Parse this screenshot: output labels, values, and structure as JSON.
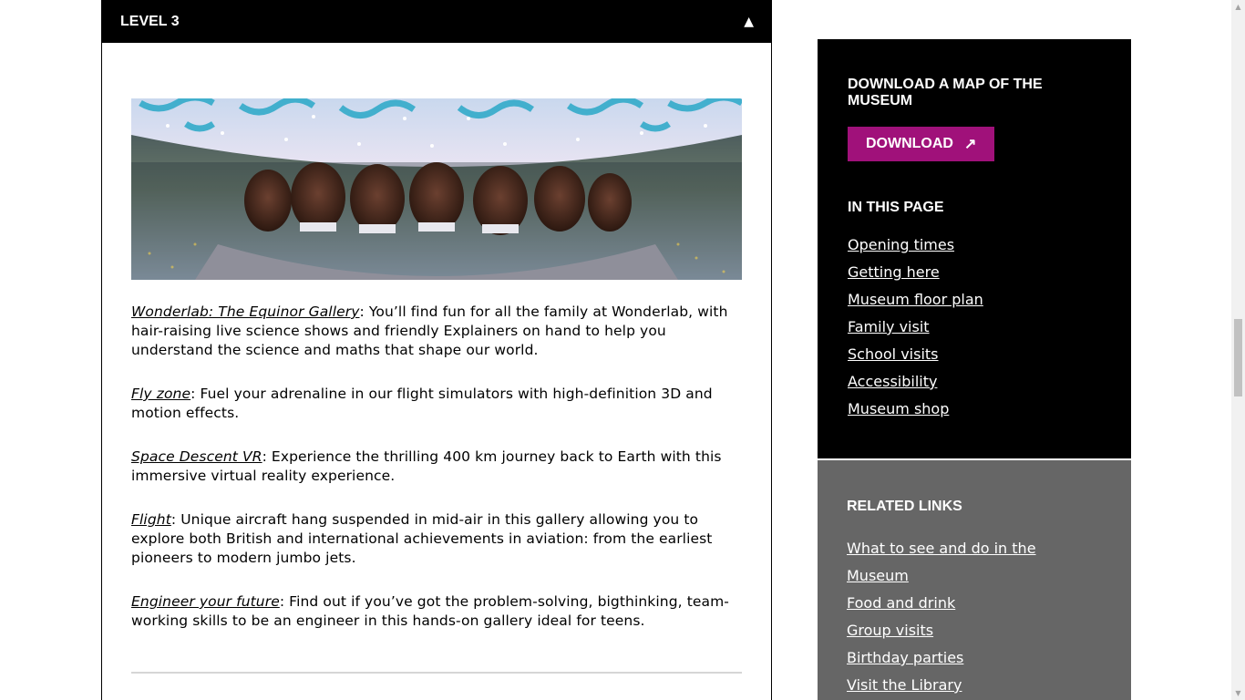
{
  "accordion": {
    "title": "LEVEL 3",
    "toggle_icon": "▲"
  },
  "hero_image": {
    "alt_name": "wonderlab-mirror-photo"
  },
  "galleries": [
    {
      "name": "Wonderlab: The Equinor Gallery",
      "text": ": You’ll find fun for all the family at Wonderlab, with hair-raising live science shows and friendly Explainers on hand to help you understand the science and maths that shape our world."
    },
    {
      "name": "Fly zone",
      "text": ": Fuel your adrenaline in our flight simulators with high-definition 3D and motion effects."
    },
    {
      "name": "Space Descent VR",
      "text": ": Experience the thrilling 400 km journey back to Earth with this immersive virtual reality experience."
    },
    {
      "name": "Flight",
      "text": ": Unique aircraft hang suspended in mid-air in this gallery allowing you to explore both British and international achievements in aviation: from the earliest pioneers to modern jumbo jets."
    },
    {
      "name": "Engineer your future",
      "text": ": Find out if you’ve got the problem-solving, bigthinking, team-working skills to be an engineer in this hands-on gallery ideal for teens."
    }
  ],
  "sidebar": {
    "download_heading": "DOWNLOAD A MAP OF THE MUSEUM",
    "download_label": "DOWNLOAD",
    "download_icon": "↗",
    "in_page_heading": "IN THIS PAGE",
    "in_page_links": [
      "Opening times",
      "Getting here",
      "Museum floor plan",
      "Family visit",
      "School visits",
      "Accessibility",
      "Museum shop"
    ],
    "related_heading": "RELATED LINKS",
    "related_links": [
      "What to see and do in the Museum",
      "Food and drink",
      "Group visits",
      "Birthday parties",
      "Visit the Library"
    ]
  },
  "colors": {
    "accent": "#a0117a",
    "sidebar_dark": "#000000",
    "sidebar_grey": "#666666"
  }
}
